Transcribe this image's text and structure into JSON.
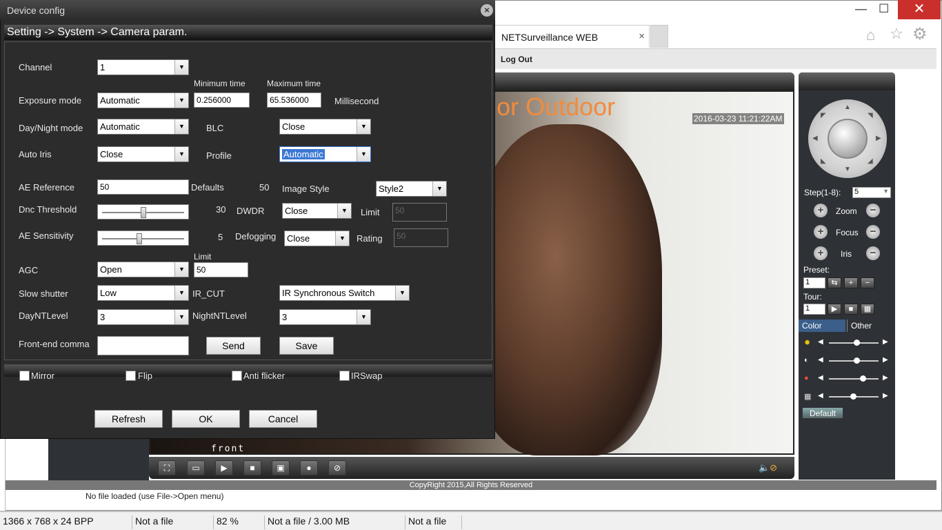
{
  "browser": {
    "tab_title": "NETSurveillance WEB",
    "tab_close": "×",
    "logout": "Log Out",
    "timestamp": "2016-03-23 11:21:22AM",
    "video_label": "front",
    "copyright": "CopyRight 2015,All Rights Reserved",
    "win_min": "—",
    "win_max": "☐",
    "win_close": "✕"
  },
  "ptz": {
    "step_label": "Step(1-8):",
    "step_value": "5",
    "zoom": "Zoom",
    "focus": "Focus",
    "iris": "Iris",
    "preset": "Preset:",
    "preset_value": "1",
    "tour": "Tour:",
    "tour_value": "1",
    "tab_color": "Color",
    "tab_other": "Other",
    "default_btn": "Default"
  },
  "annotation": "Indoor or Outdoor",
  "dialog": {
    "title": "Device config",
    "path": "Setting -> System -> Camera param.",
    "channel_label": "Channel",
    "channel_value": "1",
    "min_time_label": "Minimum time",
    "max_time_label": "Maximum time",
    "exposure_label": "Exposure mode",
    "exposure_value": "Automatic",
    "min_time_value": "0.256000",
    "max_time_value": "65.536000",
    "millisecond": "Millisecond",
    "daynight_label": "Day/Night mode",
    "daynight_value": "Automatic",
    "blc_label": "BLC",
    "blc_value": "Close",
    "autoiris_label": "Auto Iris",
    "autoiris_value": "Close",
    "profile_label": "Profile",
    "profile_value": "Automatic",
    "aeref_label": "AE Reference",
    "aeref_value": "50",
    "defaults_label": "Defaults",
    "defaults_value": "50",
    "imagestyle_label": "Image Style",
    "imagestyle_value": "Style2",
    "dnc_label": "Dnc Threshold",
    "dnc_value": "30",
    "dwdr_label": "DWDR",
    "dwdr_value": "Close",
    "limit_label": "Limit",
    "limit_value": "50",
    "aesens_label": "AE Sensitivity",
    "aesens_value": "5",
    "defog_label": "Defogging",
    "defog_value": "Close",
    "rating_label": "Rating",
    "rating_value": "50",
    "agc_limit_label": "Limit",
    "agc_label": "AGC",
    "agc_value": "Open",
    "agc_limit_value": "50",
    "slowshutter_label": "Slow shutter",
    "slowshutter_value": "Low",
    "ircut_label": "IR_CUT",
    "ircut_value": "IR Synchronous Switch",
    "dayntl_label": "DayNTLevel",
    "dayntl_value": "3",
    "nightntl_label": "NightNTLevel",
    "nightntl_value": "3",
    "frontend_label": "Front-end comma",
    "frontend_value": "",
    "send_btn": "Send",
    "save_btn": "Save",
    "mirror": "Mirror",
    "flip": "Flip",
    "antiflicker": "Anti flicker",
    "irswap": "IRSwap",
    "refresh_btn": "Refresh",
    "ok_btn": "OK",
    "cancel_btn": "Cancel",
    "close_x": "×"
  },
  "viewer": {
    "no_file": "No file loaded (use File->Open menu)",
    "status": [
      "1366 x 768 x 24 BPP",
      "Not a file",
      "82 %",
      "Not a file / 3.00 MB",
      "Not a file"
    ]
  },
  "slider_levels": [
    0.55,
    0.55,
    0.68,
    0.48
  ],
  "dialog_slider_levels": {
    "dnc": 0.5,
    "aesens": 0.45
  },
  "colors": {
    "annotation": "#f28b3b",
    "highlight": "#3b78d4"
  }
}
